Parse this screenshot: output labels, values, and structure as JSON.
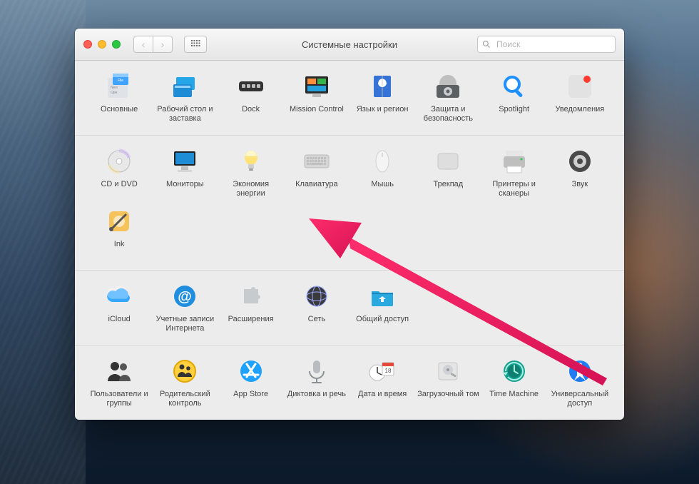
{
  "window": {
    "title": "Системные настройки",
    "search_placeholder": "Поиск"
  },
  "sections": [
    {
      "items": [
        {
          "id": "general",
          "label": "Основные",
          "icon": "general"
        },
        {
          "id": "desktop",
          "label": "Рабочий стол и заставка",
          "icon": "desktop"
        },
        {
          "id": "dock",
          "label": "Dock",
          "icon": "dock"
        },
        {
          "id": "mission",
          "label": "Mission Control",
          "icon": "mission"
        },
        {
          "id": "language",
          "label": "Язык и регион",
          "icon": "flag"
        },
        {
          "id": "security",
          "label": "Защита и безопасность",
          "icon": "vault"
        },
        {
          "id": "spotlight",
          "label": "Spotlight",
          "icon": "spotlight"
        },
        {
          "id": "notifications",
          "label": "Уведомления",
          "icon": "notify"
        }
      ]
    },
    {
      "items": [
        {
          "id": "cddvd",
          "label": "CD и DVD",
          "icon": "disc"
        },
        {
          "id": "monitors",
          "label": "Мониторы",
          "icon": "monitor"
        },
        {
          "id": "energy",
          "label": "Экономия энергии",
          "icon": "bulb"
        },
        {
          "id": "keyboard",
          "label": "Клавиатура",
          "icon": "keyboard"
        },
        {
          "id": "mouse",
          "label": "Мышь",
          "icon": "mouse"
        },
        {
          "id": "trackpad",
          "label": "Трекпад",
          "icon": "trackpad"
        },
        {
          "id": "printers",
          "label": "Принтеры и сканеры",
          "icon": "printer"
        },
        {
          "id": "sound",
          "label": "Звук",
          "icon": "speaker"
        },
        {
          "id": "ink",
          "label": "Ink",
          "icon": "ink"
        }
      ]
    },
    {
      "items": [
        {
          "id": "icloud",
          "label": "iCloud",
          "icon": "cloud"
        },
        {
          "id": "internet",
          "label": "Учетные записи Интернета",
          "icon": "at"
        },
        {
          "id": "extensions",
          "label": "Расширения",
          "icon": "puzzle"
        },
        {
          "id": "network",
          "label": "Сеть",
          "icon": "globe"
        },
        {
          "id": "sharing",
          "label": "Общий доступ",
          "icon": "folder"
        }
      ]
    },
    {
      "items": [
        {
          "id": "users",
          "label": "Пользователи и группы",
          "icon": "users"
        },
        {
          "id": "parental",
          "label": "Родительский контроль",
          "icon": "parental"
        },
        {
          "id": "appstore",
          "label": "App Store",
          "icon": "appstore"
        },
        {
          "id": "dictation",
          "label": "Диктовка и речь",
          "icon": "mic"
        },
        {
          "id": "datetime",
          "label": "Дата и время",
          "icon": "datetime"
        },
        {
          "id": "startup",
          "label": "Загрузочный том",
          "icon": "hdd"
        },
        {
          "id": "timemachine",
          "label": "Time Machine",
          "icon": "timemachine"
        },
        {
          "id": "accessibility",
          "label": "Универсальный доступ",
          "icon": "accessibility"
        }
      ]
    }
  ],
  "annotation": {
    "arrow_target": "keyboard"
  }
}
